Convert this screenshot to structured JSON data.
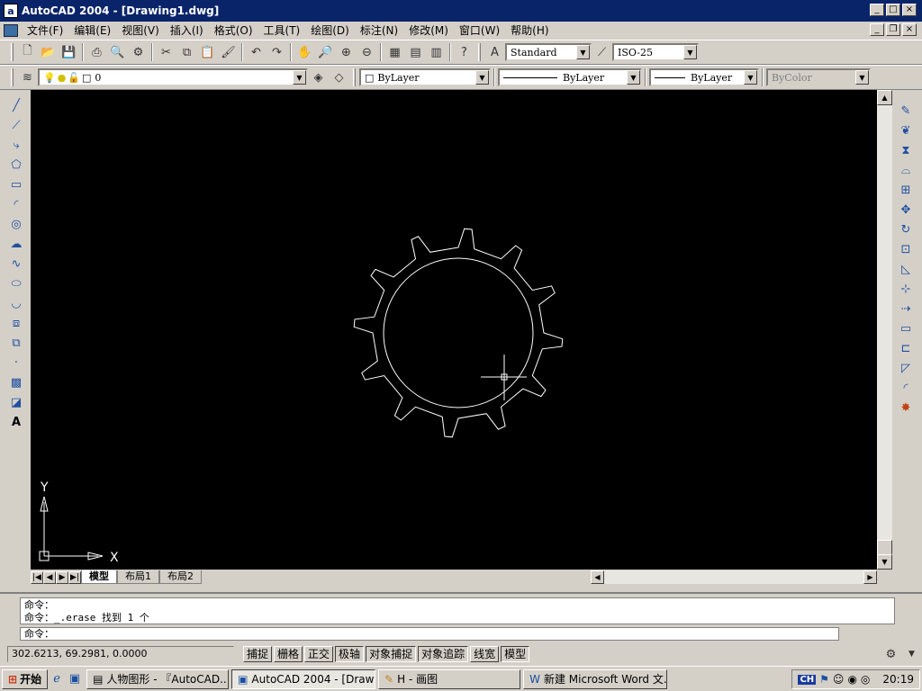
{
  "window": {
    "title": "AutoCAD 2004 - [Drawing1.dwg]",
    "app_icon": "a"
  },
  "menu": [
    "文件(F)",
    "编辑(E)",
    "视图(V)",
    "插入(I)",
    "格式(O)",
    "工具(T)",
    "绘图(D)",
    "标注(N)",
    "修改(M)",
    "窗口(W)",
    "帮助(H)"
  ],
  "toolbar": {
    "text_style": "Standard",
    "dim_style": "ISO-25"
  },
  "properties": {
    "layer": "0",
    "color": "ByLayer",
    "linetype": "ByLayer",
    "lineweight": "ByLayer",
    "plotstyle": "ByColor"
  },
  "ucs": {
    "x_label": "X",
    "y_label": "Y"
  },
  "gear": {
    "tooth_count": 12
  },
  "tabs": [
    "模型",
    "布局1",
    "布局2"
  ],
  "command": {
    "history": [
      "命令：",
      "命令：_.erase 找到 1 个"
    ],
    "prompt": "命令："
  },
  "status": {
    "coords": "302.6213,  69.2981,  0.0000",
    "toggles": [
      "捕捉",
      "栅格",
      "正交",
      "极轴",
      "对象捕捉",
      "对象追踪",
      "线宽",
      "模型"
    ],
    "on_toggles": [
      "极轴",
      "对象捕捉",
      "对象追踪",
      "模型"
    ]
  },
  "taskbar": {
    "start": "开始",
    "tasks": [
      "人物图形 - 『AutoCAD...",
      "AutoCAD 2004 - [Drawin...",
      "H - 画图",
      "新建 Microsoft Word 文..."
    ],
    "active_task": 1,
    "ime": "CH",
    "clock": "20:19"
  },
  "colors": {
    "titlebar": "#0a246a",
    "canvas": "#000000",
    "drawing_line": "#ffffff"
  }
}
